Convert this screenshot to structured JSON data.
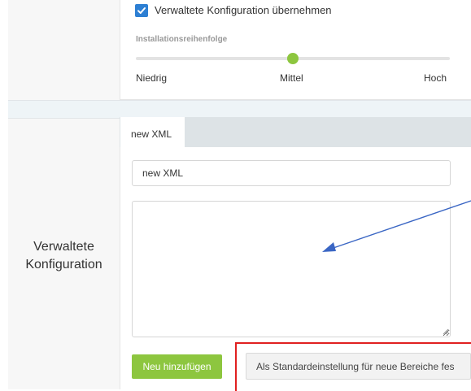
{
  "settings": {
    "checkbox_label": "Verwaltete Konfiguration übernehmen",
    "checkbox_checked": true,
    "install_order_label": "Installationsreihenfolge",
    "install_order_ticks": [
      "Niedrig",
      "Mittel",
      "Hoch"
    ],
    "install_order_value": "Mittel"
  },
  "section": {
    "label_line1": "Verwaltete",
    "label_line2": "Konfiguration"
  },
  "tabs": [
    {
      "label": "new XML",
      "active": true
    }
  ],
  "config": {
    "name_value": "new XML",
    "xml_value": ""
  },
  "actions": {
    "add_label": "Neu hinzufügen",
    "default_label": "Als Standardeinstellung für neue Bereiche fes"
  },
  "colors": {
    "accent_green": "#8dc63f",
    "checkbox_blue": "#2d7fd3",
    "annotation_red": "#e02020",
    "annotation_arrow": "#3a66c4"
  },
  "icons": {
    "checkbox": "checkmark-icon",
    "resize": "resize-grip-icon"
  }
}
